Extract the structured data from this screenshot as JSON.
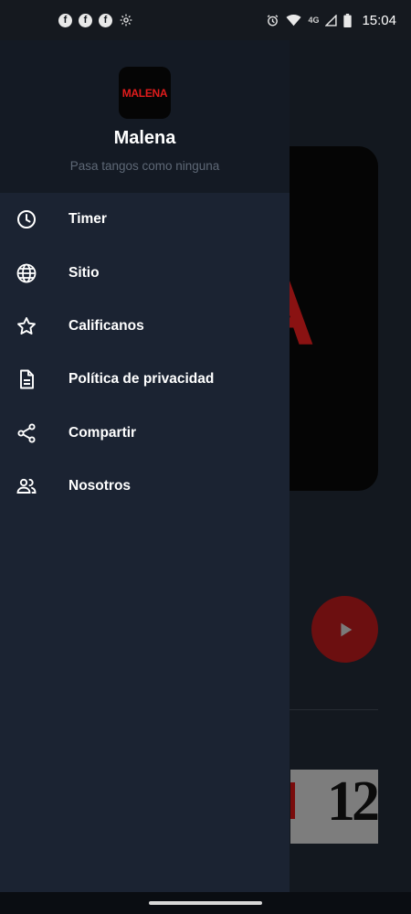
{
  "status_bar": {
    "left_icons": [
      "facebook-icon",
      "facebook-icon",
      "facebook-icon",
      "settings-icon"
    ],
    "network_type": "4G",
    "time": "15:04"
  },
  "background_app": {
    "cover_text": "A",
    "thumbnail_text": "12",
    "accent_color": "#8a1212"
  },
  "drawer": {
    "logo_text": "MALENA",
    "app_name": "Malena",
    "tagline": "Pasa tangos como ninguna",
    "items": [
      {
        "label": "Timer",
        "icon": "clock-icon"
      },
      {
        "label": "Sitio",
        "icon": "globe-icon"
      },
      {
        "label": "Calificanos",
        "icon": "star-icon"
      },
      {
        "label": "Política de privacidad",
        "icon": "document-icon"
      },
      {
        "label": "Compartir",
        "icon": "share-icon"
      },
      {
        "label": "Nosotros",
        "icon": "people-icon"
      }
    ]
  },
  "colors": {
    "drawer_bg": "#1b2332",
    "drawer_header_bg": "#141a24",
    "brand_red": "#e01c1c"
  }
}
